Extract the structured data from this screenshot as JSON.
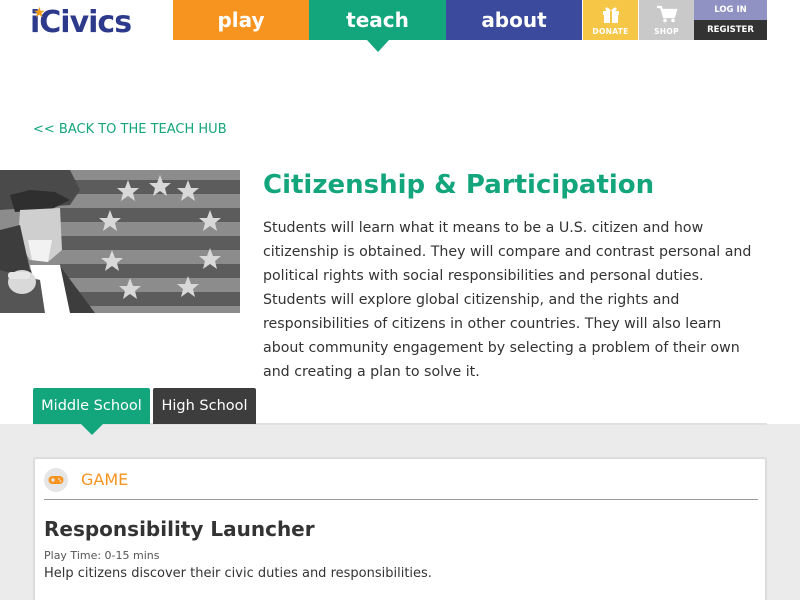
{
  "header": {
    "logo": "iCivics",
    "nav": [
      {
        "label": "play",
        "color": "#f79420"
      },
      {
        "label": "teach",
        "color": "#13a57c"
      },
      {
        "label": "about",
        "color": "#3b4a9c"
      }
    ],
    "donate_label": "DONATE",
    "shop_label": "SHOP",
    "login_label": "LOG IN",
    "register_label": "REGISTER"
  },
  "back_link": "<< BACK TO THE TEACH HUB",
  "page": {
    "title": "Citizenship & Participation",
    "description": "Students will learn what it means to be a U.S. citizen and how citizenship is obtained. They will compare and contrast personal and political rights with social responsibilities and personal duties. Students will explore global citizenship, and the rights and responsibilities of citizens in other countries. They will also learn about community engagement by selecting a problem of their own and creating a plan to solve it."
  },
  "tabs": [
    {
      "label": "Middle School",
      "active": true
    },
    {
      "label": "High School",
      "active": false
    }
  ],
  "resource": {
    "type": "GAME",
    "icon": "gamepad-icon",
    "title": "Responsibility Launcher",
    "meta": "Play Time: 0-15 mins",
    "description": "Help citizens discover their civic duties and responsibilities."
  },
  "colors": {
    "accent_green": "#13a57c",
    "accent_orange": "#f79420",
    "accent_blue": "#3b4a9c"
  }
}
